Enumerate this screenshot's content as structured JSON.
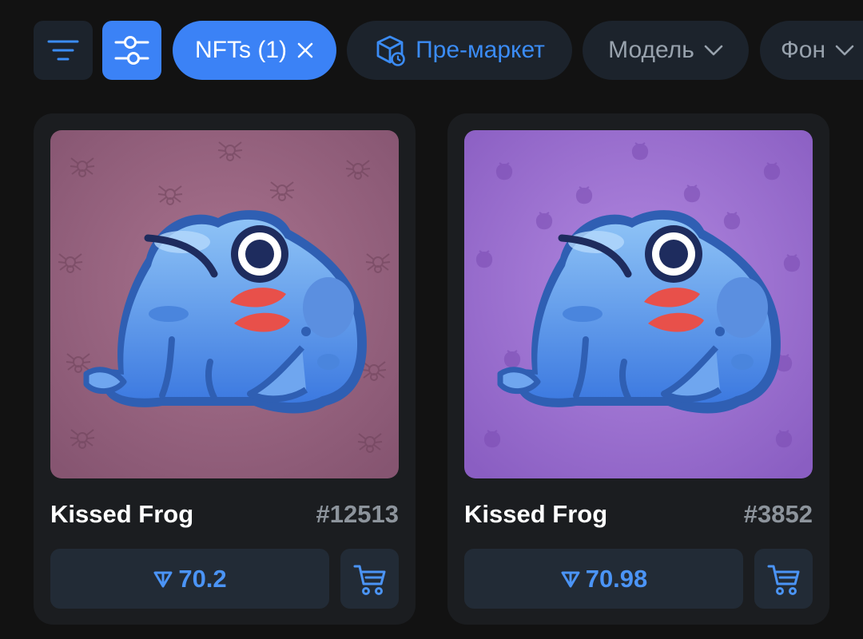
{
  "filters": {
    "sort_icon": "sort-lines-icon",
    "settings_icon": "sliders-icon",
    "nfts_label": "NFTs (1)",
    "premarket_label": "Пре-маркет",
    "model_label": "Модель",
    "background_label": "Фон"
  },
  "colors": {
    "accent": "#3b82f6",
    "chip_bg": "#1c232c",
    "card_bg": "#1b1d20"
  },
  "cards": [
    {
      "name": "Kissed Frog",
      "number": "#12513",
      "price": "70.2",
      "background_color": "#8f5f7e",
      "pattern_icon": "spider"
    },
    {
      "name": "Kissed Frog",
      "number": "#3852",
      "price": "70.98",
      "background_color": "#9a70cc",
      "pattern_icon": "strawberry"
    }
  ]
}
